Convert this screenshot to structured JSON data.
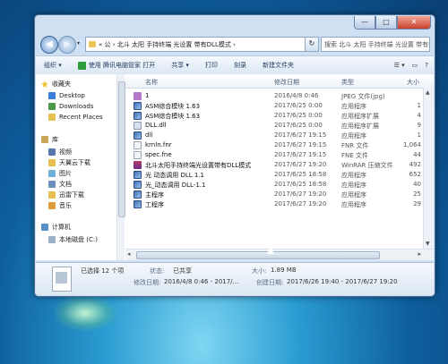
{
  "window": {
    "minimize_glyph": "—",
    "maximize_glyph": "□",
    "close_glyph": "✕"
  },
  "address_bar": {
    "path": "« 公 › 北斗 太阳 手持终端 光设置 带有DLL模式 ›",
    "refresh_glyph": "↻"
  },
  "search": {
    "placeholder": "搜索 北斗 太阳 手持终端 光设置 带有DLL模式",
    "icon": "search-icon"
  },
  "nav_glyphs": {
    "back": "◀",
    "forward": "▶",
    "dropdown": "▾"
  },
  "toolbar": {
    "organize": "组织 ▾",
    "open_with": "使用 腾讯电脑管家 打开",
    "share": "共享 ▾",
    "print": "打印",
    "burn": "刻录",
    "new_folder": "新建文件夹",
    "view_glyph": "☰ ▾",
    "pane_glyph": "▭",
    "help_glyph": "?"
  },
  "sidebar": {
    "favorites_label": "收藏夹",
    "favorites": [
      "Desktop",
      "Downloads",
      "Recent Places"
    ],
    "libraries_label": "库",
    "libraries": [
      "视频",
      "天翼云下载",
      "图片",
      "文档",
      "迅雷下载",
      "音乐"
    ],
    "computer_label": "计算机",
    "drives": [
      "本地磁盘 (C:)"
    ]
  },
  "columns": {
    "name": "名称",
    "date": "修改日期",
    "type": "类型",
    "size": "大小"
  },
  "files": [
    {
      "name": "1",
      "date": "2016/4/8 0:46",
      "type": "JPEG 文件(jpg)",
      "size": "",
      "icon": "image-icon"
    },
    {
      "name": "ASM综合模块 1.63",
      "date": "2017/6/25 0:00",
      "type": "应用程序",
      "size": "1",
      "icon": "exe-icon"
    },
    {
      "name": "ASM综合模块 1.63",
      "date": "2017/6/25 0:00",
      "type": "应用程序扩展",
      "size": "4",
      "icon": "exe-icon"
    },
    {
      "name": "DLL.dll",
      "date": "2017/6/25 0:00",
      "type": "应用程序扩展",
      "size": "9",
      "icon": "dll-icon"
    },
    {
      "name": "dll",
      "date": "2017/6/27 19:15",
      "type": "应用程序",
      "size": "1",
      "icon": "exe-icon"
    },
    {
      "name": "krnln.fnr",
      "date": "2017/6/27 19:15",
      "type": "FNR 文件",
      "size": "1,064",
      "icon": "text-icon"
    },
    {
      "name": "spec.fne",
      "date": "2017/6/27 19:15",
      "type": "FNE 文件",
      "size": "44",
      "icon": "text-icon"
    },
    {
      "name": "北斗太阳手持终端光设置带有DLL模式",
      "date": "2017/6/27 19:20",
      "type": "WinRAR 压缩文件",
      "size": "492",
      "icon": "rar-icon"
    },
    {
      "name": "光 动态调用 DLL 1.1",
      "date": "2017/6/25 18:58",
      "type": "应用程序",
      "size": "652",
      "icon": "exe-icon"
    },
    {
      "name": "光_动态调用 DLL-1.1",
      "date": "2017/6/25 18:58",
      "type": "应用程序",
      "size": "40",
      "icon": "exe-icon"
    },
    {
      "name": "主程序",
      "date": "2017/6/27 19:20",
      "type": "应用程序",
      "size": "25",
      "icon": "exe-icon"
    },
    {
      "name": "工程序",
      "date": "2017/6/27 19:20",
      "type": "应用程序",
      "size": "29",
      "icon": "exe-icon"
    }
  ],
  "details": {
    "selected": "已选择 12 个项",
    "status_label": "状态:",
    "status_value": "已共享",
    "size_label": "大小:",
    "size_value": "1.89 MB",
    "modified_label": "修改日期:",
    "modified_value": "2016/4/8 0:46 - 2017/...",
    "created_label": "创建日期:",
    "created_value": "2017/6/26 19:40 - 2017/6/27 19:20"
  }
}
